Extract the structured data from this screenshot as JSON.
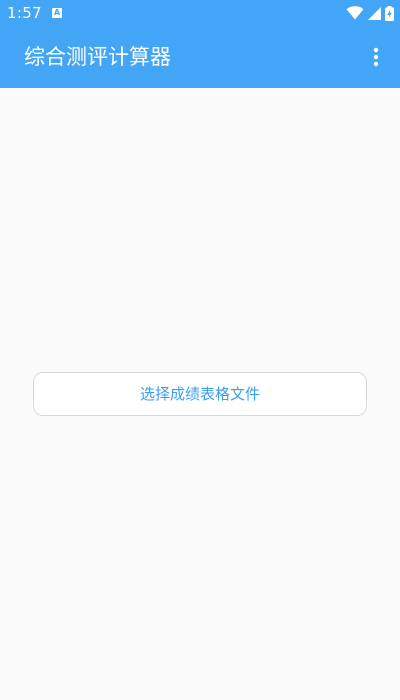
{
  "status_bar": {
    "time": "1:57",
    "notification_icon": "a-app-icon",
    "icons": [
      "wifi-icon",
      "signal-icon",
      "battery-charging-icon"
    ]
  },
  "app_bar": {
    "title": "综合测评计算器",
    "menu_icon": "more-vert-icon"
  },
  "main": {
    "select_file_label": "选择成绩表格文件"
  },
  "colors": {
    "primary": "#42a5f5",
    "background": "#fafafa",
    "button_text": "#3b9ff0",
    "button_border": "#d9d9d9"
  }
}
